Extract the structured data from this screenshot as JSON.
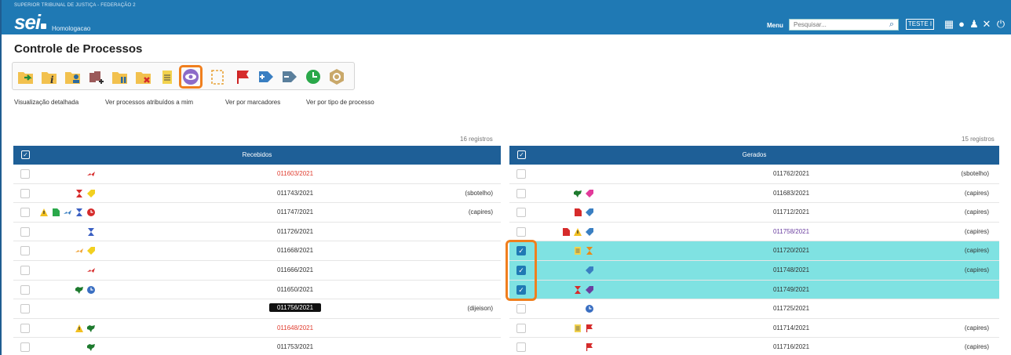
{
  "header": {
    "org": "SUPERIOR TRIBUNAL DE JUSTIÇA - FEDERAÇÃO 2",
    "logo": "sei",
    "environment": "Homologacao",
    "menu_label": "Menu",
    "search_placeholder": "Pesquisar...",
    "unit_button": "TESTE I"
  },
  "page_title": "Controle de Processos",
  "toolbar": {
    "tools": [
      "send-process-icon",
      "process-info-icon",
      "assign-user-icon",
      "add-block-icon",
      "sobrestar-icon",
      "close-process-icon",
      "annotation-icon",
      "view-icon",
      "select-icon",
      "flag-icon",
      "add-tag-icon",
      "remove-tag-icon",
      "schedule-icon",
      "search-process-icon"
    ],
    "highlighted": "view-icon"
  },
  "links": [
    "Visualização detalhada",
    "Ver processos atribuídos a mim",
    "Ver por marcadores",
    "Ver por tipo de processo"
  ],
  "received": {
    "count_text": "16 registros",
    "title": "Recebidos",
    "rows": [
      {
        "icons": [
          "red-arrow"
        ],
        "number": "011603/2021",
        "style": "red",
        "user": "",
        "checked": false
      },
      {
        "icons": [
          "red-hourglass",
          "yellow-tag"
        ],
        "number": "011743/2021",
        "style": "",
        "user": "(sbotelho)",
        "checked": false
      },
      {
        "icons": [
          "warning",
          "green-doc",
          "blue-arrow",
          "blue-hourglass",
          "red-clock"
        ],
        "number": "011747/2021",
        "style": "",
        "user": "(capires)",
        "checked": false
      },
      {
        "icons": [
          "blue-hourglass"
        ],
        "number": "011726/2021",
        "style": "",
        "user": "",
        "checked": false
      },
      {
        "icons": [
          "orange-arrow",
          "yellow-tag"
        ],
        "number": "011668/2021",
        "style": "",
        "user": "",
        "checked": false
      },
      {
        "icons": [
          "red-arrow"
        ],
        "number": "011666/2021",
        "style": "",
        "user": "",
        "checked": false
      },
      {
        "icons": [
          "green-map",
          "blue-clock"
        ],
        "number": "011650/2021",
        "style": "",
        "user": "",
        "checked": false
      },
      {
        "icons": [],
        "number": "011756/2021",
        "style": "tag",
        "user": "(dijeison)",
        "checked": false
      },
      {
        "icons": [
          "warning",
          "green-map"
        ],
        "number": "011648/2021",
        "style": "red",
        "user": "",
        "checked": false
      },
      {
        "icons": [
          "green-map"
        ],
        "number": "011753/2021",
        "style": "",
        "user": "",
        "checked": false
      }
    ]
  },
  "generated": {
    "count_text": "15 registros",
    "title": "Gerados",
    "rows": [
      {
        "icons": [],
        "number": "011762/2021",
        "style": "",
        "user": "(sbotelho)",
        "checked": false,
        "selected": false
      },
      {
        "icons": [
          "green-map",
          "pink-tag"
        ],
        "number": "011683/2021",
        "style": "",
        "user": "(capires)",
        "checked": false,
        "selected": false
      },
      {
        "icons": [
          "red-doc",
          "blue-tag"
        ],
        "number": "011712/2021",
        "style": "",
        "user": "(capires)",
        "checked": false,
        "selected": false
      },
      {
        "icons": [
          "red-doc",
          "warning",
          "blue-tag"
        ],
        "number": "011758/2021",
        "style": "purple",
        "user": "(capires)",
        "checked": false,
        "selected": false
      },
      {
        "icons": [
          "annotation",
          "orange-hourglass"
        ],
        "number": "011720/2021",
        "style": "",
        "user": "(capires)",
        "checked": true,
        "selected": true
      },
      {
        "icons": [
          "blue-tag"
        ],
        "number": "011748/2021",
        "style": "",
        "user": "(capires)",
        "checked": true,
        "selected": true
      },
      {
        "icons": [
          "red-hourglass",
          "purple-tag"
        ],
        "number": "011749/2021",
        "style": "",
        "user": "",
        "checked": true,
        "selected": true
      },
      {
        "icons": [
          "blue-clock"
        ],
        "number": "011725/2021",
        "style": "",
        "user": "",
        "checked": false,
        "selected": false
      },
      {
        "icons": [
          "annotation",
          "red-flag"
        ],
        "number": "011714/2021",
        "style": "",
        "user": "(capires)",
        "checked": false,
        "selected": false
      },
      {
        "icons": [
          "red-flag"
        ],
        "number": "011716/2021",
        "style": "",
        "user": "(capires)",
        "checked": false,
        "selected": false
      }
    ]
  },
  "colors": {
    "topbar": "#1f79b4",
    "table_header": "#1e5f97",
    "selected_row": "#7fe2e2",
    "highlight": "#f07f1e"
  }
}
